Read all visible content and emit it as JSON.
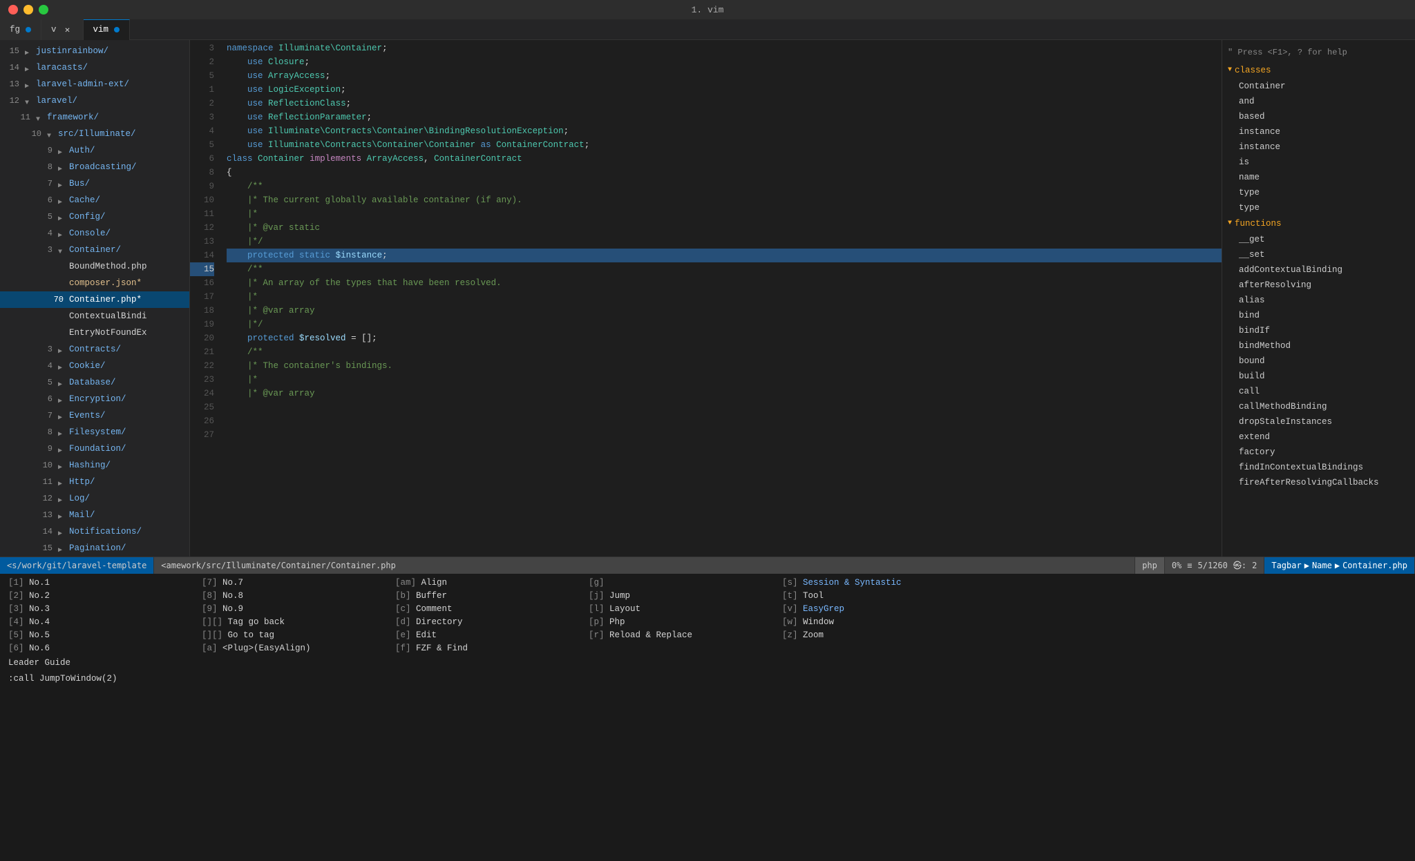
{
  "titlebar": {
    "title": "1. vim"
  },
  "tabs": [
    {
      "id": "fg",
      "label": "fg",
      "active": false,
      "dot": true,
      "closeable": false
    },
    {
      "id": "v",
      "label": "v",
      "active": false,
      "dot": false,
      "closeable": true
    },
    {
      "id": "vim",
      "label": "vim",
      "active": true,
      "dot": true,
      "closeable": false
    }
  ],
  "sidebar": {
    "items": [
      {
        "line": "15",
        "indent": 1,
        "arrow": "right",
        "label": "justinrainbow/",
        "type": "dir"
      },
      {
        "line": "14",
        "indent": 1,
        "arrow": "right",
        "label": "laracasts/",
        "type": "dir"
      },
      {
        "line": "13",
        "indent": 1,
        "arrow": "right",
        "label": "laravel-admin-ext/",
        "type": "dir"
      },
      {
        "line": "12",
        "indent": 1,
        "arrow": "down",
        "label": "laravel/",
        "type": "dir"
      },
      {
        "line": "11",
        "indent": 2,
        "arrow": "down",
        "label": "framework/",
        "type": "dir"
      },
      {
        "line": "10",
        "indent": 3,
        "arrow": "down",
        "label": "src/Illuminate/",
        "type": "dir"
      },
      {
        "line": "9",
        "indent": 4,
        "arrow": "right",
        "label": "Auth/",
        "type": "dir"
      },
      {
        "line": "8",
        "indent": 4,
        "arrow": "right",
        "label": "Broadcasting/",
        "type": "dir"
      },
      {
        "line": "7",
        "indent": 4,
        "arrow": "right",
        "label": "Bus/",
        "type": "dir"
      },
      {
        "line": "6",
        "indent": 4,
        "arrow": "right",
        "label": "Cache/",
        "type": "dir"
      },
      {
        "line": "5",
        "indent": 4,
        "arrow": "right",
        "label": "Config/",
        "type": "dir"
      },
      {
        "line": "4",
        "indent": 4,
        "arrow": "right",
        "label": "Console/",
        "type": "dir"
      },
      {
        "line": "3",
        "indent": 4,
        "arrow": "down",
        "label": "Container/",
        "type": "dir"
      },
      {
        "line": "",
        "indent": 5,
        "arrow": "",
        "label": "BoundMethod.php",
        "type": "file"
      },
      {
        "line": "",
        "indent": 5,
        "arrow": "",
        "label": "composer.json*",
        "type": "modified"
      },
      {
        "line": "70",
        "indent": 5,
        "arrow": "",
        "label": "Container.php*",
        "type": "active-file"
      },
      {
        "line": "",
        "indent": 5,
        "arrow": "",
        "label": "ContextualBindi",
        "type": "file"
      },
      {
        "line": "",
        "indent": 5,
        "arrow": "",
        "label": "EntryNotFoundEx",
        "type": "file"
      },
      {
        "line": "3",
        "indent": 4,
        "arrow": "right",
        "label": "Contracts/",
        "type": "dir"
      },
      {
        "line": "4",
        "indent": 4,
        "arrow": "right",
        "label": "Cookie/",
        "type": "dir"
      },
      {
        "line": "5",
        "indent": 4,
        "arrow": "right",
        "label": "Database/",
        "type": "dir"
      },
      {
        "line": "6",
        "indent": 4,
        "arrow": "right",
        "label": "Encryption/",
        "type": "dir"
      },
      {
        "line": "7",
        "indent": 4,
        "arrow": "right",
        "label": "Events/",
        "type": "dir"
      },
      {
        "line": "8",
        "indent": 4,
        "arrow": "right",
        "label": "Filesystem/",
        "type": "dir"
      },
      {
        "line": "9",
        "indent": 4,
        "arrow": "right",
        "label": "Foundation/",
        "type": "dir"
      },
      {
        "line": "10",
        "indent": 4,
        "arrow": "right",
        "label": "Hashing/",
        "type": "dir"
      },
      {
        "line": "11",
        "indent": 4,
        "arrow": "right",
        "label": "Http/",
        "type": "dir"
      },
      {
        "line": "12",
        "indent": 4,
        "arrow": "right",
        "label": "Log/",
        "type": "dir"
      },
      {
        "line": "13",
        "indent": 4,
        "arrow": "right",
        "label": "Mail/",
        "type": "dir"
      },
      {
        "line": "14",
        "indent": 4,
        "arrow": "right",
        "label": "Notifications/",
        "type": "dir"
      },
      {
        "line": "15",
        "indent": 4,
        "arrow": "right",
        "label": "Pagination/",
        "type": "dir"
      }
    ]
  },
  "code": {
    "lines": [
      {
        "num": "",
        "content": "",
        "tokens": []
      },
      {
        "num": "2",
        "content": "namespace Illuminate\\Container;",
        "raw": true
      },
      {
        "num": "",
        "content": "",
        "tokens": []
      },
      {
        "num": "5",
        "content": "    use Closure;",
        "raw": true
      },
      {
        "num": "",
        "content": "",
        "tokens": []
      },
      {
        "num": "1",
        "content": "    use ArrayAccess;",
        "raw": true
      },
      {
        "num": "2",
        "content": "    use LogicException;",
        "raw": true
      },
      {
        "num": "3",
        "content": "    use ReflectionClass;",
        "raw": true
      },
      {
        "num": "4",
        "content": "    use ReflectionParameter;",
        "raw": true
      },
      {
        "num": "5",
        "content": "    use Illuminate\\Contracts\\Container\\BindingResolutionException;",
        "raw": true
      },
      {
        "num": "6",
        "content": "    use Illuminate\\Contracts\\Container\\Container as ContainerContract;",
        "raw": true
      },
      {
        "num": "",
        "content": "",
        "tokens": []
      },
      {
        "num": "8",
        "content": "class Container implements ArrayAccess, ContainerContract",
        "raw": true
      },
      {
        "num": "9",
        "content": "{",
        "raw": true
      },
      {
        "num": "10",
        "content": "    /**",
        "comment": true
      },
      {
        "num": "11",
        "content": "    |* The current globally available container (if any).",
        "comment": true
      },
      {
        "num": "12",
        "content": "    |*",
        "comment": true
      },
      {
        "num": "13",
        "content": "    |* @var static",
        "comment": true
      },
      {
        "num": "14",
        "content": "    |*/",
        "comment": true
      },
      {
        "num": "15",
        "content": "    protected static $instance;",
        "raw": true
      },
      {
        "num": "16",
        "content": "",
        "raw": true
      },
      {
        "num": "17",
        "content": "    /**",
        "comment": true
      },
      {
        "num": "18",
        "content": "    |* An array of the types that have been resolved.",
        "comment": true
      },
      {
        "num": "19",
        "content": "    |*",
        "comment": true
      },
      {
        "num": "20",
        "content": "    |* @var array",
        "comment": true
      },
      {
        "num": "21",
        "content": "    |*/",
        "comment": true
      },
      {
        "num": "22",
        "content": "    protected $resolved = [];",
        "raw": true
      },
      {
        "num": "23",
        "content": "",
        "raw": true
      },
      {
        "num": "24",
        "content": "    /**",
        "comment": true
      },
      {
        "num": "25",
        "content": "    |* The container's bindings.",
        "comment": true
      },
      {
        "num": "26",
        "content": "    |*",
        "comment": true
      },
      {
        "num": "27",
        "content": "    |* @var array",
        "comment": true
      }
    ]
  },
  "tags": {
    "classes_label": "classes",
    "classes": [
      "Container",
      "and",
      "based",
      "instance",
      "instance",
      "is",
      "name",
      "type",
      "type"
    ],
    "functions_label": "functions",
    "functions": [
      "__get",
      "__set",
      "addContextualBinding",
      "afterResolving",
      "alias",
      "bind",
      "bindIf",
      "bindMethod",
      "bound",
      "build",
      "call",
      "callMethodBinding",
      "dropStaleInstances",
      "extend",
      "factory",
      "findInContextualBindings",
      "fireAfterResolvingCallbacks"
    ],
    "help": "\" Press <F1>, ? for help"
  },
  "statusbar": {
    "path1": "<s/work/git/laravel-template",
    "path2": "<amework/src/Illuminate/Container/Container.php",
    "filetype": "php",
    "percent": "0%",
    "lines": "5/1260",
    "cols": "2",
    "tagbar": "Tagbar",
    "name": "Name",
    "filename": "Container.php"
  },
  "menu": {
    "rows": [
      [
        {
          "key": "[1]",
          "label": "No.1"
        },
        {
          "key": "[7]",
          "label": "No.7"
        },
        {
          "key": "[am]",
          "label": "Align"
        },
        {
          "key": "[g]",
          "label": ""
        },
        {
          "key": "[s]",
          "label": "Session & Syntastic"
        }
      ],
      [
        {
          "key": "[2]",
          "label": "No.2"
        },
        {
          "key": "[8]",
          "label": "No.8"
        },
        {
          "key": "[b]",
          "label": "Buffer"
        },
        {
          "key": "[j]",
          "label": "Jump"
        },
        {
          "key": "[t]",
          "label": "Tool"
        }
      ],
      [
        {
          "key": "[3]",
          "label": "No.3"
        },
        {
          "key": "[9]",
          "label": "No.9"
        },
        {
          "key": "[c]",
          "label": "Comment"
        },
        {
          "key": "[l]",
          "label": "Layout"
        },
        {
          "key": "[v]",
          "label": "EasyGrep"
        }
      ],
      [
        {
          "key": "[4]",
          "label": "No.4"
        },
        {
          "key": "[][]",
          "label": "Tag go back"
        },
        {
          "key": "[d]",
          "label": "Directory"
        },
        {
          "key": "[p]",
          "label": "Php"
        },
        {
          "key": "[w]",
          "label": "Window"
        }
      ],
      [
        {
          "key": "[5]",
          "label": "No.5"
        },
        {
          "key": "[][]",
          "label": "Go to tag"
        },
        {
          "key": "[e]",
          "label": "Edit"
        },
        {
          "key": "[r]",
          "label": "Reload & Replace"
        },
        {
          "key": "[z]",
          "label": "Zoom"
        }
      ],
      [
        {
          "key": "[6]",
          "label": "No.6"
        },
        {
          "key": "[a]",
          "label": "<Plug>(EasyAlign)"
        },
        {
          "key": "[f]",
          "label": "FZF & Find"
        },
        {
          "key": "",
          "label": ""
        },
        {
          "key": "",
          "label": ""
        }
      ]
    ],
    "leader": "Leader Guide",
    "command": ":call JumpToWindow(2)"
  }
}
